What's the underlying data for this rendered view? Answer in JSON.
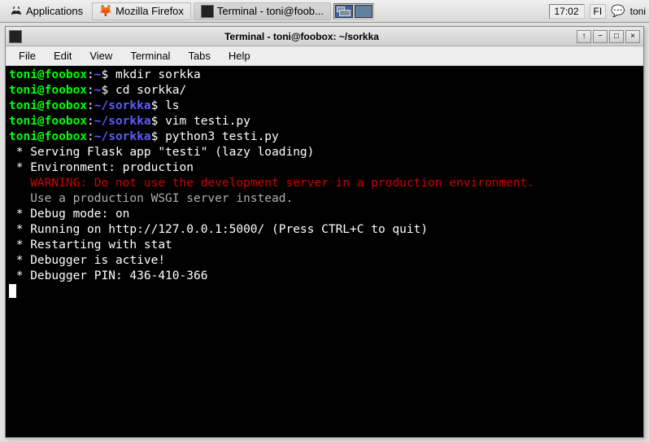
{
  "taskbar": {
    "applications": "Applications",
    "firefox": "Mozilla Firefox",
    "terminal_task": "Terminal - toni@foob...",
    "clock": "17:02",
    "lang": "FI",
    "user": "toni"
  },
  "window": {
    "title": "Terminal - toni@foobox: ~/sorkka",
    "menus": [
      "File",
      "Edit",
      "View",
      "Terminal",
      "Tabs",
      "Help"
    ]
  },
  "term": {
    "l1": {
      "userhost": "toni@foobox",
      "sep": ":",
      "path": "~",
      "prompt": "$ ",
      "cmd": "mkdir sorkka"
    },
    "l2": {
      "userhost": "toni@foobox",
      "sep": ":",
      "path": "~",
      "prompt": "$ ",
      "cmd": "cd sorkka/"
    },
    "l3": {
      "userhost": "toni@foobox",
      "sep": ":",
      "path": "~/sorkka",
      "prompt": "$ ",
      "cmd": "ls"
    },
    "l4": {
      "userhost": "toni@foobox",
      "sep": ":",
      "path": "~/sorkka",
      "prompt": "$ ",
      "cmd": "vim testi.py"
    },
    "l5": {
      "userhost": "toni@foobox",
      "sep": ":",
      "path": "~/sorkka",
      "prompt": "$ ",
      "cmd": "python3 testi.py"
    },
    "o1": " * Serving Flask app \"testi\" (lazy loading)",
    "o2": " * Environment: production",
    "o3": "   WARNING: Do not use the development server in a production environment.",
    "o4": "   Use a production WSGI server instead.",
    "o5": " * Debug mode: on",
    "o6": " * Running on http://127.0.0.1:5000/ (Press CTRL+C to quit)",
    "o7": " * Restarting with stat",
    "o8": " * Debugger is active!",
    "o9": " * Debugger PIN: 436-410-366"
  }
}
